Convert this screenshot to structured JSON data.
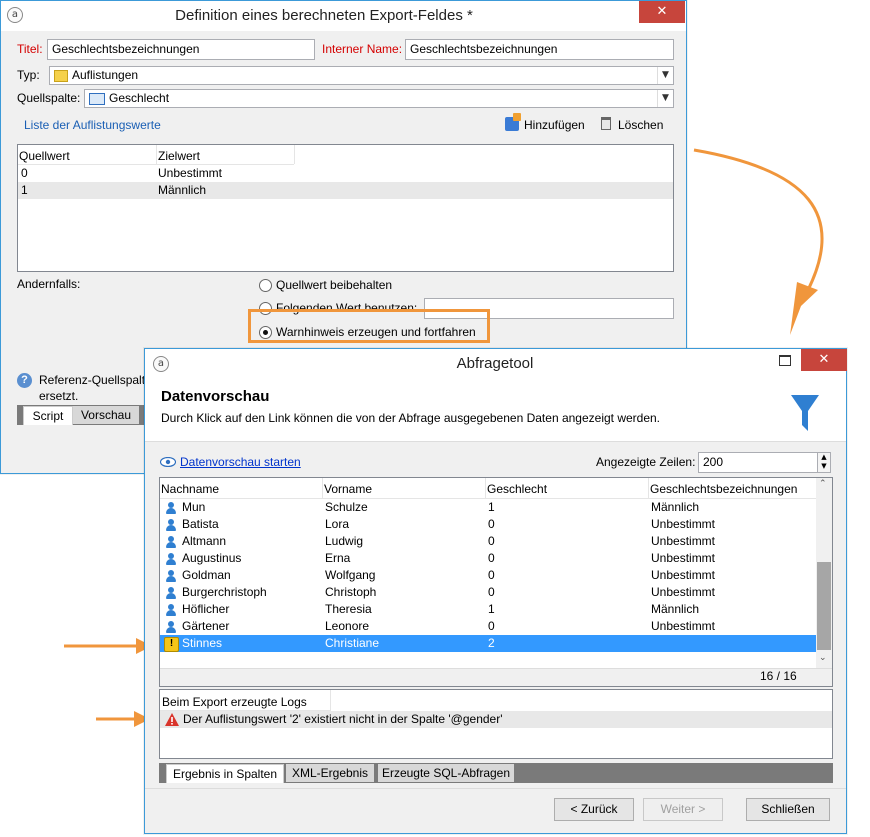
{
  "dialog1": {
    "title": "Definition eines berechneten Export-Feldes *",
    "titel_label": "Titel:",
    "titel_value": "Geschlechtsbezeichnungen",
    "interner_label": "Interner Name:",
    "interner_value": "Geschlechtsbezeichnungen",
    "typ_label": "Typ:",
    "typ_value": "Auflistungen",
    "quellspalte_label": "Quellspalte:",
    "quellspalte_value": "Geschlecht",
    "list_link": "Liste der Auflistungswerte",
    "add_label": "Hinzufügen",
    "delete_label": "Löschen",
    "columns": [
      "Quellwert",
      "Zielwert"
    ],
    "rows": [
      {
        "quellwert": "0",
        "zielwert": "Unbestimmt"
      },
      {
        "quellwert": "1",
        "zielwert": "Männlich"
      }
    ],
    "andernfalls_label": "Andernfalls:",
    "radio_keep": "Quellwert beibehalten",
    "radio_use": "Folgenden Wert benutzen:",
    "radio_warn": "Warnhinweis erzeugen und fortfahren",
    "help_text_1": "Referenz-Quellspalte",
    "help_text_2": "ersetzt.",
    "tabs": [
      "Script",
      "Vorschau"
    ]
  },
  "dialog2": {
    "title": "Abfragetool",
    "section_title": "Datenvorschau",
    "description": "Durch Klick auf den Link können die von der Abfrage ausgegebenen Daten angezeigt werden.",
    "preview_link": "Datenvorschau starten",
    "rows_label": "Angezeigte Zeilen:",
    "rows_value": "200",
    "columns": [
      "Nachname",
      "Vorname",
      "Geschlecht",
      "Geschlechtsbezeichnungen"
    ],
    "rows": [
      {
        "nachname": "Mun",
        "vorname": "Schulze",
        "geschlecht": "1",
        "bez": "Männlich"
      },
      {
        "nachname": "Batista",
        "vorname": "Lora",
        "geschlecht": "0",
        "bez": "Unbestimmt"
      },
      {
        "nachname": "Altmann",
        "vorname": "Ludwig",
        "geschlecht": "0",
        "bez": "Unbestimmt"
      },
      {
        "nachname": "Augustinus",
        "vorname": "Erna",
        "geschlecht": "0",
        "bez": "Unbestimmt"
      },
      {
        "nachname": "Goldman",
        "vorname": "Wolfgang",
        "geschlecht": "0",
        "bez": "Unbestimmt"
      },
      {
        "nachname": "Burgerchristoph",
        "vorname": "Christoph",
        "geschlecht": "0",
        "bez": "Unbestimmt"
      },
      {
        "nachname": "Höflicher",
        "vorname": "Theresia",
        "geschlecht": "1",
        "bez": "Männlich"
      },
      {
        "nachname": "Gärtener",
        "vorname": "Leonore",
        "geschlecht": "0",
        "bez": "Unbestimmt"
      },
      {
        "nachname": "Stinnes",
        "vorname": "Christiane",
        "geschlecht": "2",
        "bez": ""
      }
    ],
    "count": "16 / 16",
    "logs_header": "Beim Export erzeugte Logs",
    "log_message": "Der Auflistungswert '2' existiert nicht in der Spalte '@gender'",
    "tabs": [
      "Ergebnis in Spalten",
      "XML-Ergebnis",
      "Erzeugte SQL-Abfragen"
    ],
    "back_button": "< Zurück",
    "next_button": "Weiter >",
    "close_button": "Schließen"
  },
  "colors": {
    "accent": "#3c9ad8",
    "selection": "#3399ff",
    "annotation": "#f0963c",
    "close": "#c7453c",
    "error": "#d40000"
  }
}
